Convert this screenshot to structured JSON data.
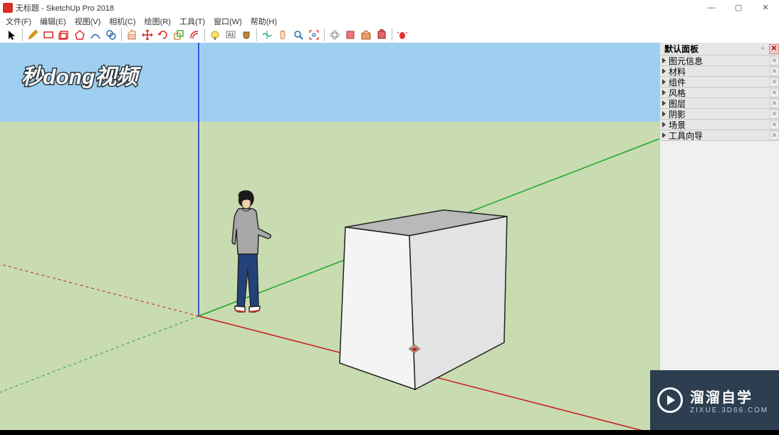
{
  "title": "无标题 - SketchUp Pro 2018",
  "window_controls": {
    "min": "—",
    "max": "▢",
    "close": "✕"
  },
  "menu": [
    {
      "label": "文件(F)"
    },
    {
      "label": "编辑(E)"
    },
    {
      "label": "视图(V)"
    },
    {
      "label": "相机(C)"
    },
    {
      "label": "绘图(R)"
    },
    {
      "label": "工具(T)"
    },
    {
      "label": "窗口(W)"
    },
    {
      "label": "帮助(H)"
    }
  ],
  "toolbar_icons": [
    "select-arrow-icon",
    "pencil-icon",
    "rectangle-icon",
    "shapes-icon",
    "pentagon-icon",
    "arc-icon",
    "circles-icon",
    "pushpull-icon",
    "move-icon",
    "rotate-icon",
    "scale-icon",
    "offset-icon",
    "tape-icon",
    "text-icon",
    "paint-icon",
    "mirror-icon",
    "hand-icon",
    "zoom-icon",
    "zoom-extents-icon",
    "orbit-icon",
    "component-icon",
    "3dwarehouse-icon",
    "extension-icon",
    "bug-icon"
  ],
  "panel": {
    "title": "默认面板",
    "sections": [
      {
        "label": "图元信息"
      },
      {
        "label": "材料"
      },
      {
        "label": "组件"
      },
      {
        "label": "风格"
      },
      {
        "label": "图层"
      },
      {
        "label": "阴影"
      },
      {
        "label": "场景"
      },
      {
        "label": "工具向导"
      }
    ]
  },
  "watermark_tl": "秒dong视频",
  "watermark_br": {
    "title": "溜溜自学",
    "sub": "ZIXUE.3D66.COM"
  }
}
